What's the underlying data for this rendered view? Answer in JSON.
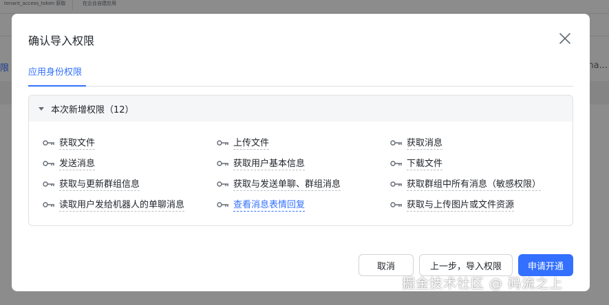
{
  "background": {
    "top_text_1": "tenant_access_token 获取",
    "top_text_2": "在企业自建应用",
    "left_text": "限",
    "right_text": "na..."
  },
  "modal": {
    "title": "确认导入权限",
    "tab_label": "应用身份权限",
    "section_title": "本次新增权限（12）",
    "permissions": [
      {
        "label": "获取文件",
        "link": false
      },
      {
        "label": "上传文件",
        "link": false
      },
      {
        "label": "获取消息",
        "link": false
      },
      {
        "label": "发送消息",
        "link": false
      },
      {
        "label": "获取用户基本信息",
        "link": false
      },
      {
        "label": "下载文件",
        "link": false
      },
      {
        "label": "获取与更新群组信息",
        "link": false
      },
      {
        "label": "获取与发送单聊、群组消息",
        "link": false
      },
      {
        "label": "获取群组中所有消息（敏感权限）",
        "link": false
      },
      {
        "label": "读取用户发给机器人的单聊消息",
        "link": false
      },
      {
        "label": "查看消息表情回复",
        "link": true
      },
      {
        "label": "获取与上传图片或文件资源",
        "link": false
      }
    ],
    "buttons": {
      "cancel": "取消",
      "previous": "上一步，导入权限",
      "apply": "申请开通"
    }
  },
  "watermark": "掘金技术社区 @ 码流之上",
  "icons": {
    "close": "close-icon",
    "caret": "caret-down-icon",
    "key": "key-icon"
  },
  "colors": {
    "accent": "#3370ff",
    "overlay": "rgba(0,0,0,0.45)"
  }
}
